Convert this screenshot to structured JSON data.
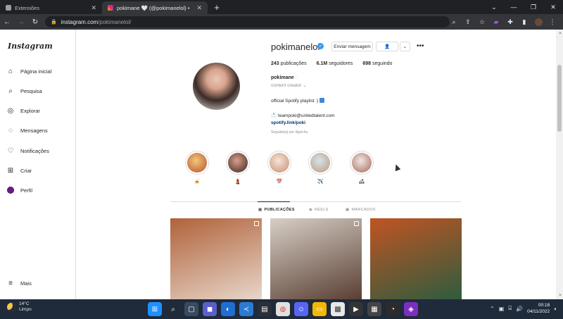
{
  "browser": {
    "tabs": [
      {
        "title": "Extensões",
        "active": false
      },
      {
        "title": "pokimane 🤍 (@pokimanelol) •",
        "active": true
      }
    ],
    "new_tab": "+",
    "url_host": "instagram.com",
    "url_path": "/pokimanelol/",
    "window_controls": [
      "⌄",
      "—",
      "❐",
      "✕"
    ]
  },
  "sidebar": {
    "logo": "Instagram",
    "items": [
      {
        "label": "Página inicial",
        "icon": "home-icon"
      },
      {
        "label": "Pesquisa",
        "icon": "search-icon"
      },
      {
        "label": "Explorar",
        "icon": "compass-icon"
      },
      {
        "label": "Mensagens",
        "icon": "messenger-icon"
      },
      {
        "label": "Notificações",
        "icon": "heart-icon"
      },
      {
        "label": "Criar",
        "icon": "plus-square-icon"
      },
      {
        "label": "Perfil",
        "icon": "profile-avatar-icon"
      }
    ],
    "more": "Mais"
  },
  "profile": {
    "username": "pokimanelol",
    "message_button": "Enviar mensagem",
    "stats": {
      "posts": "243",
      "posts_label": "publicações",
      "followers": "6.1M",
      "followers_label": "seguidores",
      "following": "698",
      "following_label": "seguindo"
    },
    "full_name": "pokimane",
    "category": "content creator",
    "bio_line": "official Spotify playlist :)",
    "email": "teampoki@unitedtalent.com",
    "link": "spotify.link/poki",
    "followed_by": "Seguido(a) por lilypichu"
  },
  "highlights": [
    {
      "label": "🍝",
      "color1": "#f2c77a",
      "color2": "#b5512a"
    },
    {
      "label": "💄",
      "color1": "#d9a08c",
      "color2": "#3b2320"
    },
    {
      "label": "📅",
      "color1": "#f4e6d8",
      "color2": "#c88b6e"
    },
    {
      "label": "✈️",
      "color1": "#d7e3ea",
      "color2": "#b99a7a"
    },
    {
      "label": "🛋",
      "color1": "#eee8e2",
      "color2": "#a4665a"
    }
  ],
  "profile_tabs": [
    {
      "label": "PUBLICAÇÕES",
      "icon": "grid-icon"
    },
    {
      "label": "REELS",
      "icon": "reels-icon"
    },
    {
      "label": "MARCADOS",
      "icon": "tagged-icon"
    }
  ],
  "posts": [
    {
      "color_a": "#b0623a",
      "color_b": "#e7d6c9"
    },
    {
      "color_a": "#d7cfc6",
      "color_b": "#5a3f33"
    },
    {
      "color_a": "#c05423",
      "color_b": "#2f5c3e"
    }
  ],
  "taskbar": {
    "temp": "14°C",
    "condition": "Limpo",
    "time": "00:18",
    "date": "04/11/2022"
  }
}
